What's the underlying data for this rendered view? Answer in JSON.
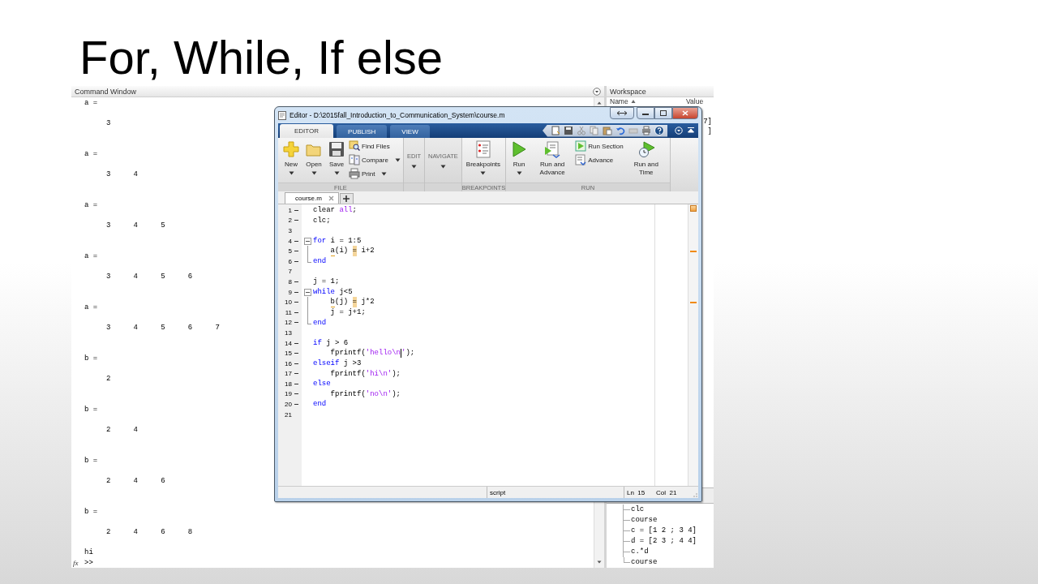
{
  "slide": {
    "title": "For, While, If else"
  },
  "command_window": {
    "title": "Command Window",
    "output": [
      {
        "variable": "a =",
        "values": [
          "3"
        ]
      },
      {
        "variable": "a =",
        "values": [
          "3",
          "4"
        ]
      },
      {
        "variable": "a =",
        "values": [
          "3",
          "4",
          "5"
        ]
      },
      {
        "variable": "a =",
        "values": [
          "3",
          "4",
          "5",
          "6"
        ]
      },
      {
        "variable": "a =",
        "values": [
          "3",
          "4",
          "5",
          "6",
          "7"
        ]
      },
      {
        "variable": "b =",
        "values": [
          "2"
        ]
      },
      {
        "variable": "b =",
        "values": [
          "2",
          "4"
        ]
      },
      {
        "variable": "b =",
        "values": [
          "2",
          "4",
          "6"
        ]
      },
      {
        "variable": "b =",
        "values": [
          "2",
          "4",
          "6",
          "8"
        ]
      }
    ],
    "printed": "hi",
    "function_button": "fx",
    "prompt": ">>"
  },
  "workspace": {
    "title": "Workspace",
    "columns": [
      "Name",
      "Value"
    ],
    "rows": [
      {
        "value": "7]"
      },
      {
        "value": "]"
      }
    ]
  },
  "command_history": {
    "items": [
      {
        "text": "clc"
      },
      {
        "text": "course"
      },
      {
        "text": "c = [1 2 ; 3 4]"
      },
      {
        "text": "d = [2 3 ; 4 4]"
      },
      {
        "text": "c.*d"
      },
      {
        "text": "course"
      }
    ]
  },
  "editor": {
    "title": "Editor - D:\\2015fall_Introduction_to_Communication_System\\course.m",
    "tabs": [
      {
        "label": "EDITOR",
        "selected": true
      },
      {
        "label": "PUBLISH",
        "selected": false
      },
      {
        "label": "VIEW",
        "selected": false
      }
    ],
    "groups": [
      {
        "label": "FILE",
        "kind": "normal",
        "items": [
          {
            "kind": "large",
            "label": "New",
            "dropdown": true
          },
          {
            "kind": "large",
            "label": "Open",
            "dropdown": true
          },
          {
            "kind": "large",
            "label": "Save",
            "dropdown": true
          },
          {
            "kind": "stack",
            "items": [
              {
                "label": "Find Files",
                "dropdown": false
              },
              {
                "label": "Compare",
                "dropdown": true
              },
              {
                "label": "Print",
                "dropdown": true
              }
            ]
          }
        ]
      },
      {
        "label": "EDIT",
        "kind": "collapsed"
      },
      {
        "label": "NAVIGATE",
        "kind": "collapsed"
      },
      {
        "label": "BREAKPOINTS",
        "kind": "normal",
        "items": [
          {
            "kind": "large",
            "label": "Breakpoints",
            "dropdown": true
          }
        ]
      },
      {
        "label": "RUN",
        "kind": "normal",
        "items": [
          {
            "kind": "large",
            "label": "Run",
            "dropdown": true
          },
          {
            "kind": "large",
            "label": "Run and Advance",
            "dropdown": false
          },
          {
            "kind": "stack",
            "items": [
              {
                "label": "Run Section",
                "dropdown": false
              },
              {
                "label": "Advance",
                "dropdown": false
              }
            ]
          },
          {
            "kind": "large",
            "label": "Run and Time",
            "dropdown": false
          }
        ]
      }
    ],
    "files": [
      {
        "label": "course.m",
        "selected": true
      }
    ],
    "lines": [
      {
        "number": "1",
        "executable": true,
        "tokens": [
          {
            "kind": "plain",
            "text": "clear "
          },
          {
            "kind": "string",
            "text": "all"
          },
          {
            "kind": "plain",
            "text": ";"
          }
        ]
      },
      {
        "number": "2",
        "executable": true,
        "tokens": [
          {
            "kind": "plain",
            "text": "clc;"
          }
        ]
      },
      {
        "number": "3",
        "executable": false
      },
      {
        "number": "4",
        "executable": true,
        "fold_start": true,
        "tokens": [
          {
            "kind": "keyword",
            "text": "for"
          },
          {
            "kind": "plain",
            "text": " i = 1:5"
          }
        ]
      },
      {
        "number": "5",
        "executable": true,
        "fold_body": true,
        "indented": true,
        "tokens": [
          {
            "kind": "underline",
            "text": "a"
          },
          {
            "kind": "plain",
            "text": "(i) "
          },
          {
            "kind": "highlight",
            "text": "="
          },
          {
            "kind": "plain",
            "text": " i+2"
          }
        ]
      },
      {
        "number": "6",
        "executable": true,
        "fold_end": true,
        "tokens": [
          {
            "kind": "keyword",
            "text": "end"
          }
        ]
      },
      {
        "number": "7",
        "executable": false
      },
      {
        "number": "8",
        "executable": true,
        "tokens": [
          {
            "kind": "plain",
            "text": "j = 1;"
          }
        ]
      },
      {
        "number": "9",
        "executable": true,
        "fold_start": true,
        "tokens": [
          {
            "kind": "keyword",
            "text": "while"
          },
          {
            "kind": "plain",
            "text": " j<5"
          }
        ]
      },
      {
        "number": "10",
        "executable": true,
        "fold_body": true,
        "indented": true,
        "tokens": [
          {
            "kind": "underline",
            "text": "b"
          },
          {
            "kind": "plain",
            "text": "(j) "
          },
          {
            "kind": "highlight",
            "text": "="
          },
          {
            "kind": "plain",
            "text": " j*2"
          }
        ]
      },
      {
        "number": "11",
        "executable": true,
        "fold_body": true,
        "indented": true,
        "tokens": [
          {
            "kind": "plain",
            "text": "j = j+1;"
          }
        ]
      },
      {
        "number": "12",
        "executable": true,
        "fold_end": true,
        "tokens": [
          {
            "kind": "keyword",
            "text": "end"
          }
        ]
      },
      {
        "number": "13",
        "executable": false
      },
      {
        "number": "14",
        "executable": true,
        "tokens": [
          {
            "kind": "keyword",
            "text": "if"
          },
          {
            "kind": "plain",
            "text": " j > 6"
          }
        ]
      },
      {
        "number": "15",
        "executable": true,
        "indented": true,
        "tokens": [
          {
            "kind": "plain",
            "text": "fprintf("
          },
          {
            "kind": "string",
            "text": "'hello\\n"
          },
          {
            "kind": "caret"
          },
          {
            "kind": "string",
            "text": "'"
          },
          {
            "kind": "plain",
            "text": ");"
          }
        ]
      },
      {
        "number": "16",
        "executable": true,
        "tokens": [
          {
            "kind": "keyword",
            "text": "elseif"
          },
          {
            "kind": "plain",
            "text": " j >3"
          }
        ]
      },
      {
        "number": "17",
        "executable": true,
        "indented": true,
        "tokens": [
          {
            "kind": "plain",
            "text": "fprintf("
          },
          {
            "kind": "string",
            "text": "'hi\\n'"
          },
          {
            "kind": "plain",
            "text": ");"
          }
        ]
      },
      {
        "number": "18",
        "executable": true,
        "tokens": [
          {
            "kind": "keyword",
            "text": "else"
          }
        ]
      },
      {
        "number": "19",
        "executable": true,
        "indented": true,
        "tokens": [
          {
            "kind": "plain",
            "text": "fprintf("
          },
          {
            "kind": "string",
            "text": "'no\\n'"
          },
          {
            "kind": "plain",
            "text": ");"
          }
        ]
      },
      {
        "number": "20",
        "executable": true,
        "tokens": [
          {
            "kind": "keyword",
            "text": "end"
          }
        ]
      },
      {
        "number": "21",
        "executable": false
      }
    ],
    "status": {
      "type": "script",
      "line": "Ln  15",
      "column": "Col  21"
    }
  }
}
